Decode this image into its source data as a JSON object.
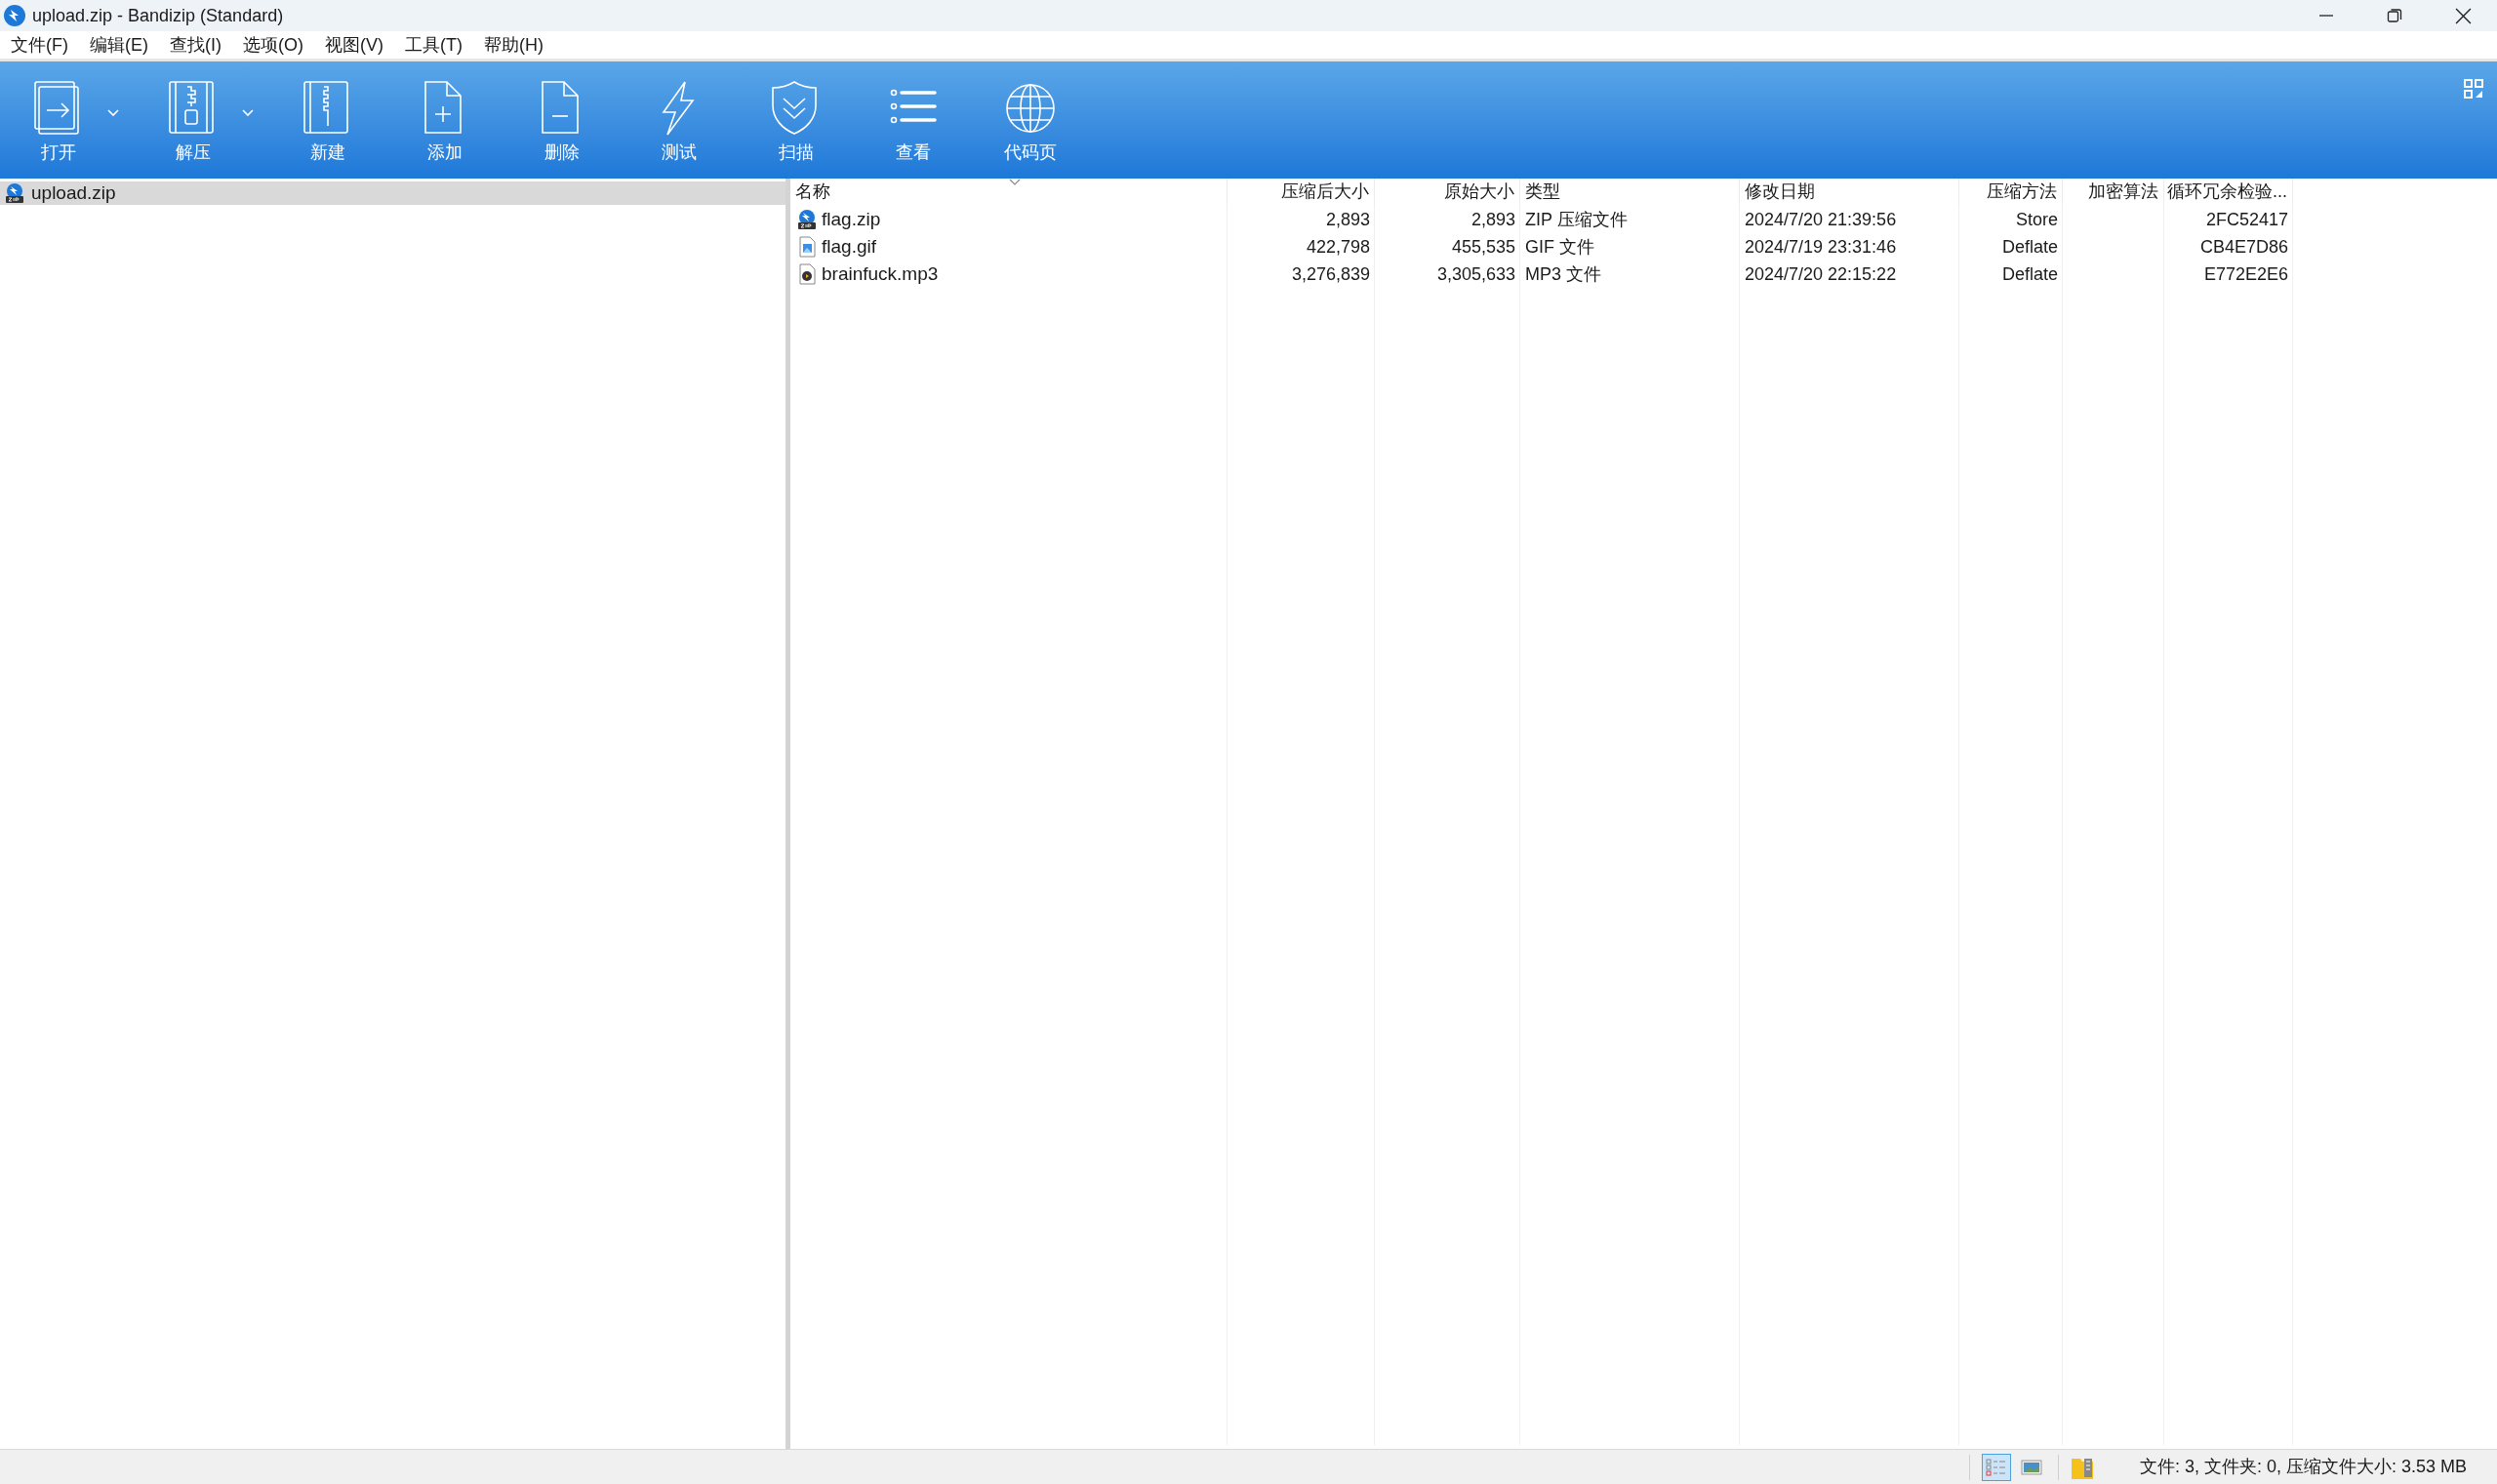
{
  "window": {
    "title": "upload.zip - Bandizip (Standard)"
  },
  "menu": [
    "文件(F)",
    "编辑(E)",
    "查找(I)",
    "选项(O)",
    "视图(V)",
    "工具(T)",
    "帮助(H)"
  ],
  "toolbar": [
    {
      "label": "打开",
      "dropdown": true
    },
    {
      "label": "解压",
      "dropdown": true
    },
    {
      "label": "新建",
      "dropdown": false
    },
    {
      "label": "添加",
      "dropdown": false
    },
    {
      "label": "删除",
      "dropdown": false
    },
    {
      "label": "测试",
      "dropdown": false
    },
    {
      "label": "扫描",
      "dropdown": false
    },
    {
      "label": "查看",
      "dropdown": false
    },
    {
      "label": "代码页",
      "dropdown": false
    }
  ],
  "tree": [
    {
      "label": "upload.zip",
      "selected": true
    }
  ],
  "table": {
    "columns": [
      {
        "label": "名称",
        "sorted": true
      },
      {
        "label": "压缩后大小",
        "sorted": false
      },
      {
        "label": "原始大小",
        "sorted": false
      },
      {
        "label": "类型",
        "sorted": false
      },
      {
        "label": "修改日期",
        "sorted": false
      },
      {
        "label": "压缩方法",
        "sorted": false
      },
      {
        "label": "加密算法",
        "sorted": false
      },
      {
        "label": "循环冗余检验...",
        "sorted": false
      }
    ],
    "rows": [
      {
        "kind": "archive",
        "cells": [
          "flag.zip",
          "2,893",
          "2,893",
          "ZIP 压缩文件",
          "2024/7/20 21:39:56",
          "Store",
          "",
          "2FC52417"
        ]
      },
      {
        "kind": "image",
        "cells": [
          "flag.gif",
          "422,798",
          "455,535",
          "GIF 文件",
          "2024/7/19 23:31:46",
          "Deflate",
          "",
          "CB4E7D86"
        ]
      },
      {
        "kind": "audio",
        "cells": [
          "brainfuck.mp3",
          "3,276,839",
          "3,305,633",
          "MP3 文件",
          "2024/7/20 22:15:22",
          "Deflate",
          "",
          "E772E2E6"
        ]
      }
    ]
  },
  "status_bar": {
    "views": [
      {
        "selected": true
      },
      {
        "selected": false
      }
    ],
    "text": "文件: 3, 文件夹: 0, 压缩文件大小: 3.53 MB"
  }
}
